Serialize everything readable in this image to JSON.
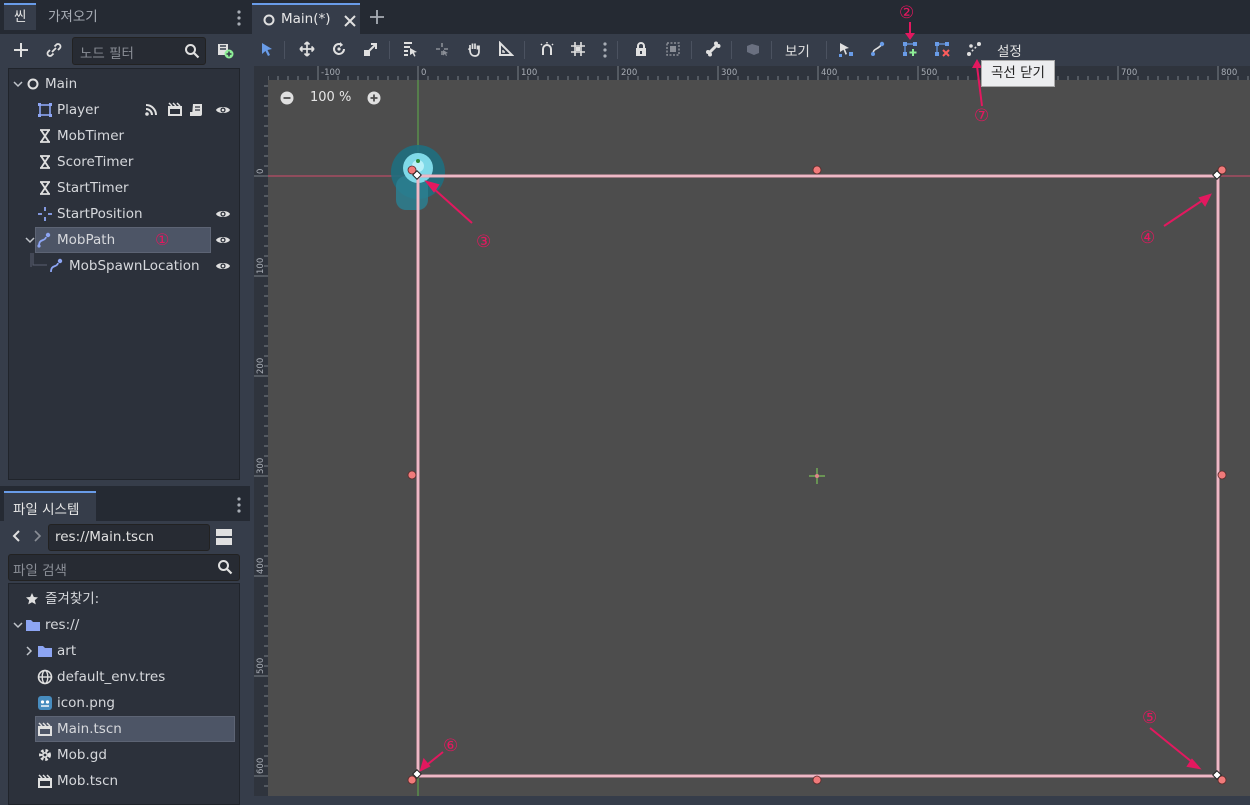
{
  "scene_dock": {
    "tabs": [
      {
        "label": "씬"
      },
      {
        "label": "가져오기"
      }
    ],
    "filter_placeholder": "노드 필터",
    "nodes": [
      {
        "label": "Main"
      },
      {
        "label": "Player"
      },
      {
        "label": "MobTimer"
      },
      {
        "label": "ScoreTimer"
      },
      {
        "label": "StartTimer"
      },
      {
        "label": "StartPosition"
      },
      {
        "label": "MobPath"
      },
      {
        "label": "MobSpawnLocation"
      }
    ]
  },
  "filesystem_dock": {
    "tab_label": "파일 시스템",
    "path": "res://Main.tscn",
    "search_placeholder": "파일 검색",
    "items": [
      {
        "label": "즐겨찾기:"
      },
      {
        "label": "res://"
      },
      {
        "label": "art"
      },
      {
        "label": "default_env.tres"
      },
      {
        "label": "icon.png"
      },
      {
        "label": "Main.tscn"
      },
      {
        "label": "Mob.gd"
      },
      {
        "label": "Mob.tscn"
      }
    ]
  },
  "editor": {
    "tab_label": "Main(*)",
    "view_menu": "보기",
    "settings_menu": "설정",
    "tooltip": "곡선 닫기",
    "zoom": "100 %",
    "ruler_h_labels": [
      "-100",
      "0",
      "100",
      "200",
      "300",
      "400",
      "500",
      "600",
      "700",
      "800"
    ],
    "ruler_v_labels": [
      "0",
      "100",
      "200",
      "300",
      "400",
      "500",
      "600"
    ]
  },
  "annotations": {
    "a1": "①",
    "a2": "②",
    "a3": "③",
    "a4": "④",
    "a5": "⑤",
    "a6": "⑥",
    "a7": "⑦"
  },
  "colors": {
    "accent": "#699ce8",
    "annotation": "#e3185f",
    "path": "#e8a8b8",
    "handle": "#f07a7a",
    "viewport": "#4d4d4d"
  }
}
